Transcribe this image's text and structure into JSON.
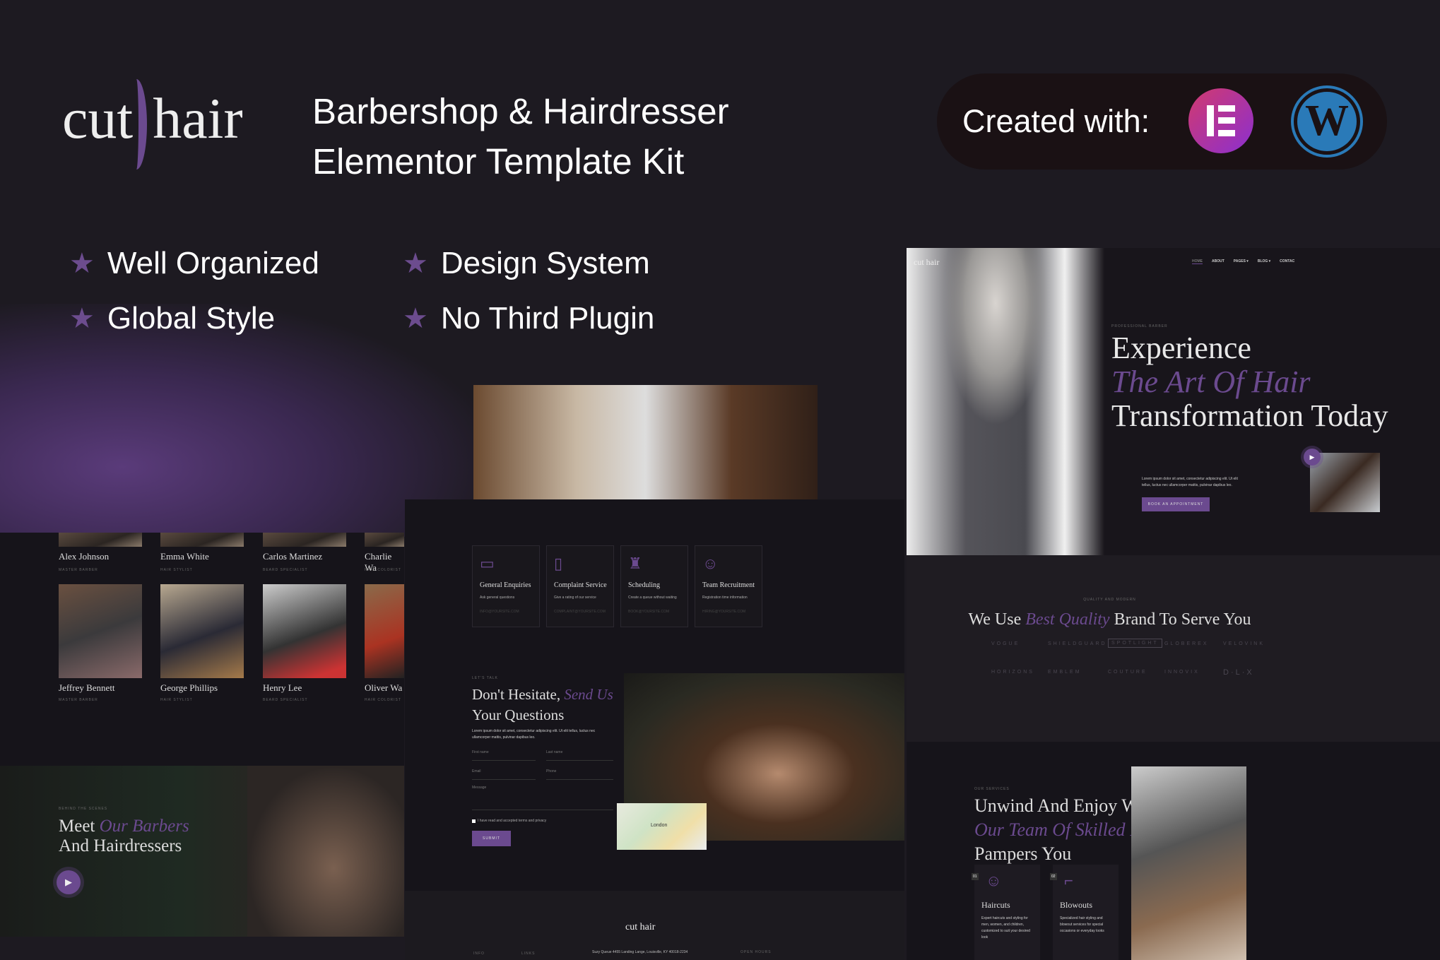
{
  "header": {
    "logo": {
      "cut": "cut",
      "hair": "hair"
    },
    "title_line1": "Barbershop & Hairdresser",
    "title_line2": "Elementor Template Kit",
    "created_with": "Created with:",
    "platforms": [
      {
        "icon": "elementor-icon",
        "color": "#c7307a"
      },
      {
        "icon": "wordpress-icon",
        "color": "#2a7ab8"
      }
    ]
  },
  "features": [
    {
      "icon": "star-icon",
      "label": "Well Organized"
    },
    {
      "icon": "star-icon",
      "label": "Design System"
    },
    {
      "icon": "star-icon",
      "label": "Global Style"
    },
    {
      "icon": "star-icon",
      "label": "No Third Plugin"
    }
  ],
  "accent": "#6b4a8f",
  "team": {
    "members": [
      {
        "name": "Alex Johnson",
        "role": "MASTER BARBER"
      },
      {
        "name": "Emma White",
        "role": "HAIR STYLIST"
      },
      {
        "name": "Carlos Martinez",
        "role": "BEARD SPECIALIST"
      },
      {
        "name": "Charlie Wa",
        "role": "HAIR COLORIST"
      },
      {
        "name": "Jeffrey Bennett",
        "role": "MASTER BARBER"
      },
      {
        "name": "George Phillips",
        "role": "HAIR STYLIST"
      },
      {
        "name": "Henry Lee",
        "role": "BEARD SPECIALIST"
      },
      {
        "name": "Oliver Wa",
        "role": "HAIR COLORIST"
      }
    ],
    "meet": {
      "label": "BEHIND THE SCENES",
      "line1": "Meet ",
      "line1_accent": "Our Barbers",
      "line2": "And Hairdressers"
    }
  },
  "contact": {
    "cards": [
      {
        "title": "General Enquiries",
        "desc": "Ask general questions",
        "email": "INFO@YOURSITE.COM"
      },
      {
        "title": "Complaint Service",
        "desc": "Give a rating of our service",
        "email": "COMPLAINT@YOURSITE.COM"
      },
      {
        "title": "Scheduling",
        "desc": "Create a queue without waiting",
        "email": "BOOK@YOURSITE.COM"
      },
      {
        "title": "Team Recruitment",
        "desc": "Registration time information",
        "email": "HIRING@YOURSITE.COM"
      }
    ],
    "label": "LET'S TALK",
    "heading1": "Don't Hesitate, ",
    "heading1_accent": "Send Us",
    "heading2": "Your Questions",
    "text": "Lorem ipsum dolor sit amet, consectetur adipiscing elit. Ut elit tellus, luctus nec ullamcorper mattis, pulvinar dapibus leo.",
    "fields": {
      "first": "First name",
      "last": "Last name",
      "email": "Email",
      "phone": "Phone",
      "message": "Message"
    },
    "consent": "I have read and accepted terms and privacy",
    "submit": "SUBMIT",
    "map_label": "London"
  },
  "footer": {
    "logo": "cut hair",
    "address": "Suzy Queue 4455 Landing Lange, Louisville, KY 40018-2234",
    "info": "INFO",
    "links": "LINKS",
    "hours": "OPEN HOURS"
  },
  "hero": {
    "logo": "cut hair",
    "nav": [
      "HOME",
      "ABOUT",
      "PAGES ▾",
      "BLOG ▾",
      "CONTAC"
    ],
    "label": "PROFESSIONAL BARBER",
    "line1": "Experience",
    "line2": "The Art Of Hair",
    "line3": "Transformation Today",
    "text": "Lorem ipsum dolor sit amet, consectetur adipiscing elit. Ut elit tellus, luctus nec ullamcorper mattis, pulvinar dapibus leo.",
    "cta": "BOOK AN APPOINTMENT"
  },
  "brands": {
    "label": "QUALITY AND MODERN",
    "h_pre": "We Use ",
    "h_accent": "Best Quality",
    "h_post": " Brand To Serve You",
    "logos": [
      "VOGUE",
      "SHIELDGUARD",
      "SPOTLIGHT",
      "GLOBEREX",
      "VELOVINK",
      "HORIZONS",
      "EMBLEM",
      "COUTURE",
      "INNOVIX",
      "D·L·X"
    ]
  },
  "services": {
    "label": "OUR SERVICES",
    "line1": "Unwind And Enjoy While",
    "line2": "Our Team Of Skilled Barbers",
    "line3": "Pampers You",
    "cards": [
      {
        "num": "01",
        "title": "Haircuts",
        "desc": "Expert haircuts and styling for men, women, and children, customized to suit your desired look"
      },
      {
        "num": "02",
        "title": "Blowouts",
        "desc": "Specialized hair styling and blowout services for special occasions or everyday looks"
      }
    ]
  }
}
